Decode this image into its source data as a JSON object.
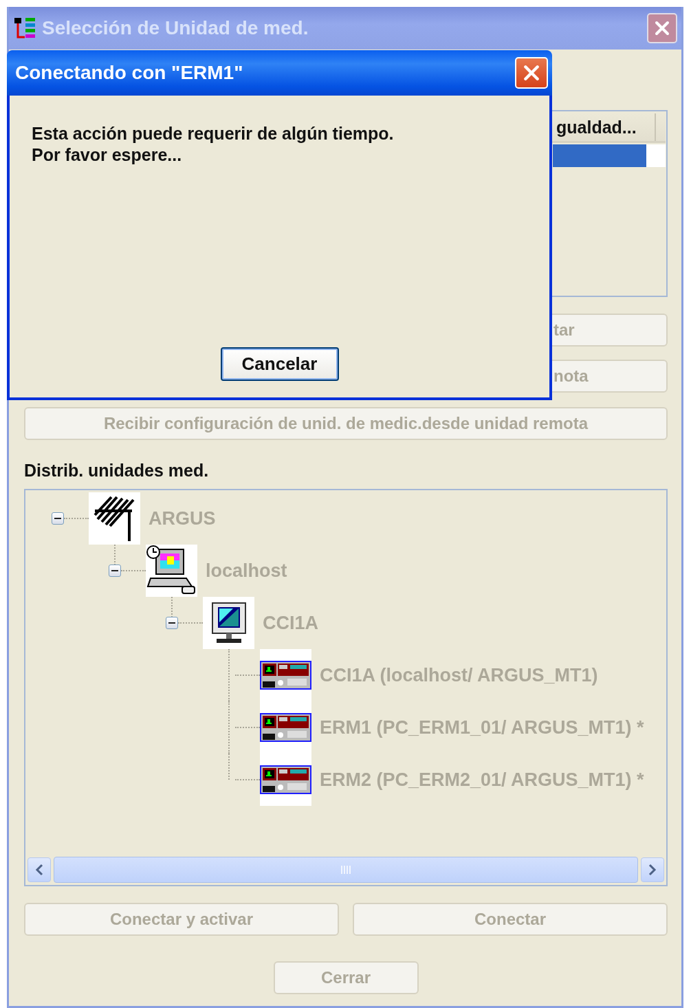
{
  "window": {
    "title": "Selección de Unidad de med.",
    "active": false
  },
  "list": {
    "columns": [
      {
        "label": "gualdad..."
      }
    ],
    "rows": [
      {
        "selected": true
      }
    ]
  },
  "side_buttons": [
    {
      "label": "tar",
      "disabled": true
    },
    {
      "label": "nota",
      "disabled": true
    }
  ],
  "receive_button": {
    "label": "Recibir configuración de unid. de medic.desde unidad remota",
    "disabled": true
  },
  "tree": {
    "label": "Distrib. unidades med.",
    "nodes": [
      {
        "label": "ARGUS",
        "kind": "antenna",
        "expanded": true,
        "children": [
          {
            "label": "localhost",
            "kind": "computer",
            "expanded": true,
            "children": [
              {
                "label": "CCI1A",
                "kind": "monitor",
                "expanded": true,
                "children": [
                  {
                    "label": "CCI1A (localhost/ ARGUS_MT1)",
                    "kind": "device"
                  },
                  {
                    "label": "ERM1 (PC_ERM1_01/ ARGUS_MT1) *",
                    "kind": "device"
                  },
                  {
                    "label": "ERM2 (PC_ERM2_01/ ARGUS_MT1) *",
                    "kind": "device"
                  }
                ]
              }
            ]
          }
        ]
      }
    ]
  },
  "buttons": [
    {
      "label": "Conectar y activar",
      "disabled": true
    },
    {
      "label": "Conectar",
      "disabled": true
    }
  ],
  "close_button": {
    "label": "Cerrar",
    "disabled": true
  },
  "dialog": {
    "title": "Conectando con \"ERM1\"",
    "message": "Esta acción puede requerir de algún tiempo.\nPor favor espere...",
    "button": "Cancelar"
  }
}
